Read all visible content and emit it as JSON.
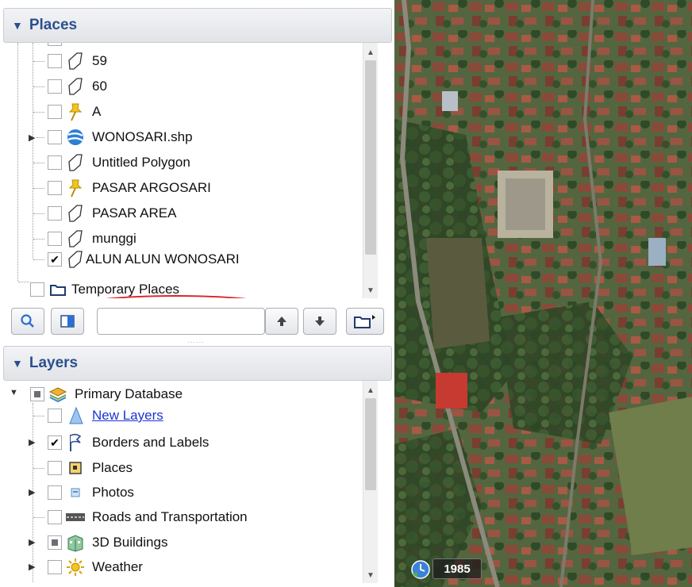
{
  "places": {
    "title": "Places",
    "items": [
      {
        "label": "59"
      },
      {
        "label": "60"
      },
      {
        "label": "A"
      },
      {
        "label": "WONOSARI.shp"
      },
      {
        "label": "Untitled Polygon"
      },
      {
        "label": "PASAR ARGOSARI"
      },
      {
        "label": "PASAR AREA"
      },
      {
        "label": "munggi"
      },
      {
        "label": "ALUN ALUN WONOSARI",
        "checked": true
      }
    ],
    "temporary_label": "Temporary Places"
  },
  "toolbar": {
    "search_value": ""
  },
  "layers": {
    "title": "Layers",
    "root_label": "Primary Database",
    "items": [
      {
        "label": "New Layers"
      },
      {
        "label": "Borders and Labels",
        "checked": true
      },
      {
        "label": "Places"
      },
      {
        "label": "Photos"
      },
      {
        "label": "Roads and Transportation"
      },
      {
        "label": "3D Buildings"
      },
      {
        "label": "Weather"
      }
    ]
  },
  "map": {
    "imagery_year": "1985"
  },
  "colors": {
    "header_text": "#2b4f8f",
    "link": "#1a33d6",
    "highlight": "#d9232a"
  }
}
